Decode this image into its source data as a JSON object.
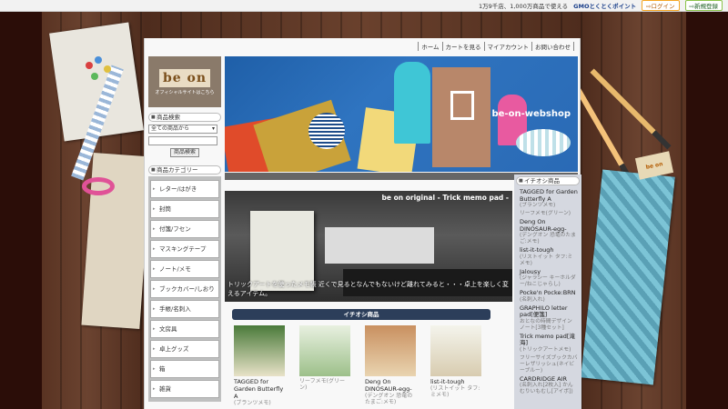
{
  "topbar": {
    "notice": "1万9千店、1,000万商品で使える",
    "points_brand": "GMOとくとくポイント",
    "login_label": "ログイン",
    "register_label": "新規登録"
  },
  "nav": {
    "items": [
      "ホーム",
      "カートを見る",
      "マイアカウント",
      "お問い合わせ"
    ]
  },
  "logo": {
    "text": "be on",
    "sub": "オフィシャルサイトはこちら"
  },
  "search": {
    "heading": "商品検索",
    "select_value": "全ての商品から",
    "button_label": "商品検索"
  },
  "categories": {
    "heading": "商品カテゴリー",
    "items": [
      "レター/はがき",
      "封筒",
      "付箋/フセン",
      "マスキングテープ",
      "ノート/メモ",
      "ブックカバー/しおり",
      "手帳/名刺入",
      "文房具",
      "卓上グッズ",
      "箱",
      "雑貨"
    ]
  },
  "banner": {
    "title": "be-on-webshop"
  },
  "slide": {
    "title": "be on original - Trick memo pad -",
    "caption": "トリックアートを使ったメモ帳 近くで見るとなんでもないけど離れてみると・・・卓上を楽しく変えるアイテム。"
  },
  "recommended": {
    "heading": "イチオシ商品",
    "products": [
      {
        "name": "TAGGED for Garden Butterfly A",
        "desc": "(ブランツメモ)"
      },
      {
        "name": "",
        "desc": "リーフメモ(グリーン)"
      },
      {
        "name": "Deng On DINOSAUR-egg-",
        "desc": "(デングオン 恐竜のたまご:メモ)"
      },
      {
        "name": "list-it-tough",
        "desc": "(リストイット タフ:ミメモ)"
      }
    ]
  },
  "sidebar_right": {
    "heading": "イチオシ商品",
    "items": [
      {
        "name": "TAGGED for Garden Butterfly A",
        "desc": "(ブランツメモ)"
      },
      {
        "name": "",
        "desc": "リーフメモ(グリーン)"
      },
      {
        "name": "Deng On DINOSAUR-egg-",
        "desc": "(デングオン 恐竜のたまご:メモ)"
      },
      {
        "name": "list-it-tough",
        "desc": "(リストイット タフ:ミメモ)"
      },
      {
        "name": "Jalousy",
        "desc": "(ジャラシー キーホルダー/ねこじゃらし)"
      },
      {
        "name": "Pocke'n Pocke:BRN",
        "desc": "(名刺入れ)"
      },
      {
        "name": "GRAPHILO letter pad[便箋]",
        "desc": "おとなの時間デザイン ノート[3種セット]"
      },
      {
        "name": "Trick memo pad[滝海]",
        "desc": "(トリックアートメモ)"
      },
      {
        "name": "",
        "desc": "フリーサイズブックカバーレザリッシュ(ネイビーブルー)"
      },
      {
        "name": "CARDRIDGE AIR",
        "desc": "(名刺入れ[2枚入] かんむりいもむし[アイボ])"
      }
    ]
  },
  "colors": {
    "wood": "#6b4330",
    "banner_blue": "#2f74c0",
    "reco_header": "#2c3e5a"
  }
}
